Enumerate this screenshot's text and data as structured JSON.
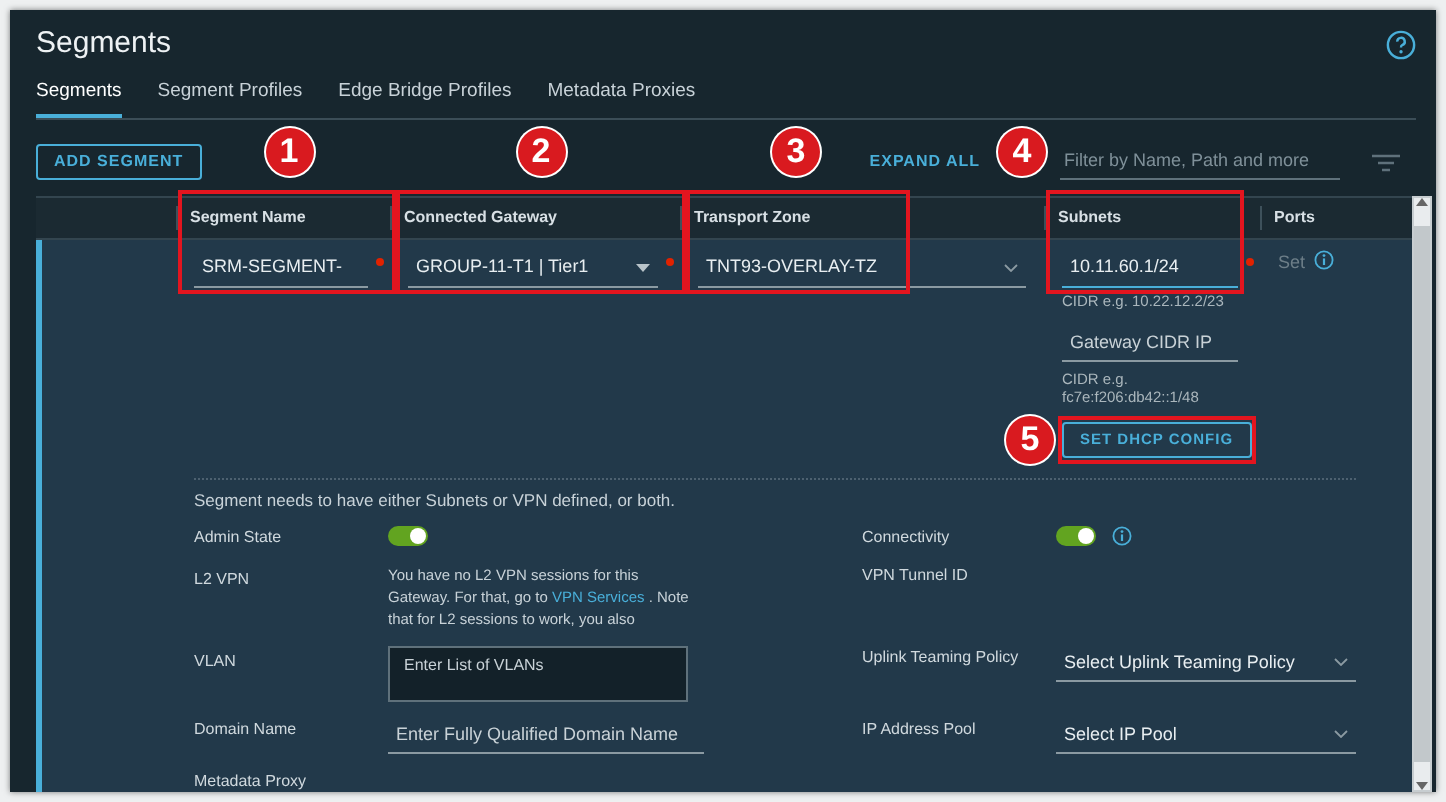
{
  "page": {
    "title": "Segments"
  },
  "tabs": [
    {
      "label": "Segments",
      "selected": true
    },
    {
      "label": "Segment Profiles",
      "selected": false
    },
    {
      "label": "Edge Bridge Profiles",
      "selected": false
    },
    {
      "label": "Metadata Proxies",
      "selected": false
    }
  ],
  "toolbar": {
    "add_button": "ADD SEGMENT",
    "expand_all": "EXPAND ALL",
    "filter": {
      "placeholder": "Filter by Name, Path and more"
    }
  },
  "table": {
    "columns": [
      "Segment Name",
      "Connected Gateway",
      "Transport Zone",
      "Subnets",
      "Ports"
    ],
    "row": {
      "expanded": true,
      "segment_name": "SRM-SEGMENT-",
      "connected_gateway": "GROUP-11-T1 | Tier1",
      "transport_zone": "TNT93-OVERLAY-TZ",
      "subnet": "10.11.60.1/24",
      "subnet_hint": "CIDR e.g. 10.22.12.2/23",
      "ipv6_placeholder": "Gateway CIDR IP",
      "ipv6_hint": "CIDR e.g. fc7e:f206:db42::1/48",
      "dhcp_button": "SET DHCP CONFIG",
      "ports": {
        "label": "Set",
        "disabled": true
      }
    },
    "form": {
      "note": "Segment needs to have either Subnets or VPN defined, or both.",
      "rows": [
        {
          "left": {
            "kind": "toggle",
            "label": "Admin State",
            "on": true
          },
          "right": {
            "kind": "toggle",
            "label": "Connectivity",
            "on": true,
            "info": true
          }
        },
        {
          "left": {
            "kind": "info",
            "label": "L2 VPN",
            "text": "You have no L2 VPN sessions for this Gateway. For that, go to",
            "link": "VPN Services",
            "text_after": ". Note that for L2 sessions to work, you also"
          },
          "right": {
            "kind": "label",
            "label": "VPN Tunnel ID"
          }
        },
        {
          "left": {
            "kind": "textarea",
            "label": "VLAN",
            "placeholder": "Enter List of VLANs"
          },
          "right": {
            "kind": "select",
            "label": "Uplink Teaming Policy",
            "placeholder": "Select Uplink Teaming Policy"
          }
        },
        {
          "left": {
            "kind": "input",
            "label": "Domain Name",
            "placeholder": "Enter Fully Qualified Domain Name"
          },
          "right": {
            "kind": "select",
            "label": "IP Address Pool",
            "placeholder": "Select IP Pool"
          }
        },
        {
          "left": {
            "kind": "label",
            "label": "Metadata Proxy"
          }
        }
      ]
    }
  },
  "annotations": [
    {
      "number": "1"
    },
    {
      "number": "2"
    },
    {
      "number": "3"
    },
    {
      "number": "4"
    },
    {
      "number": "5"
    }
  ]
}
